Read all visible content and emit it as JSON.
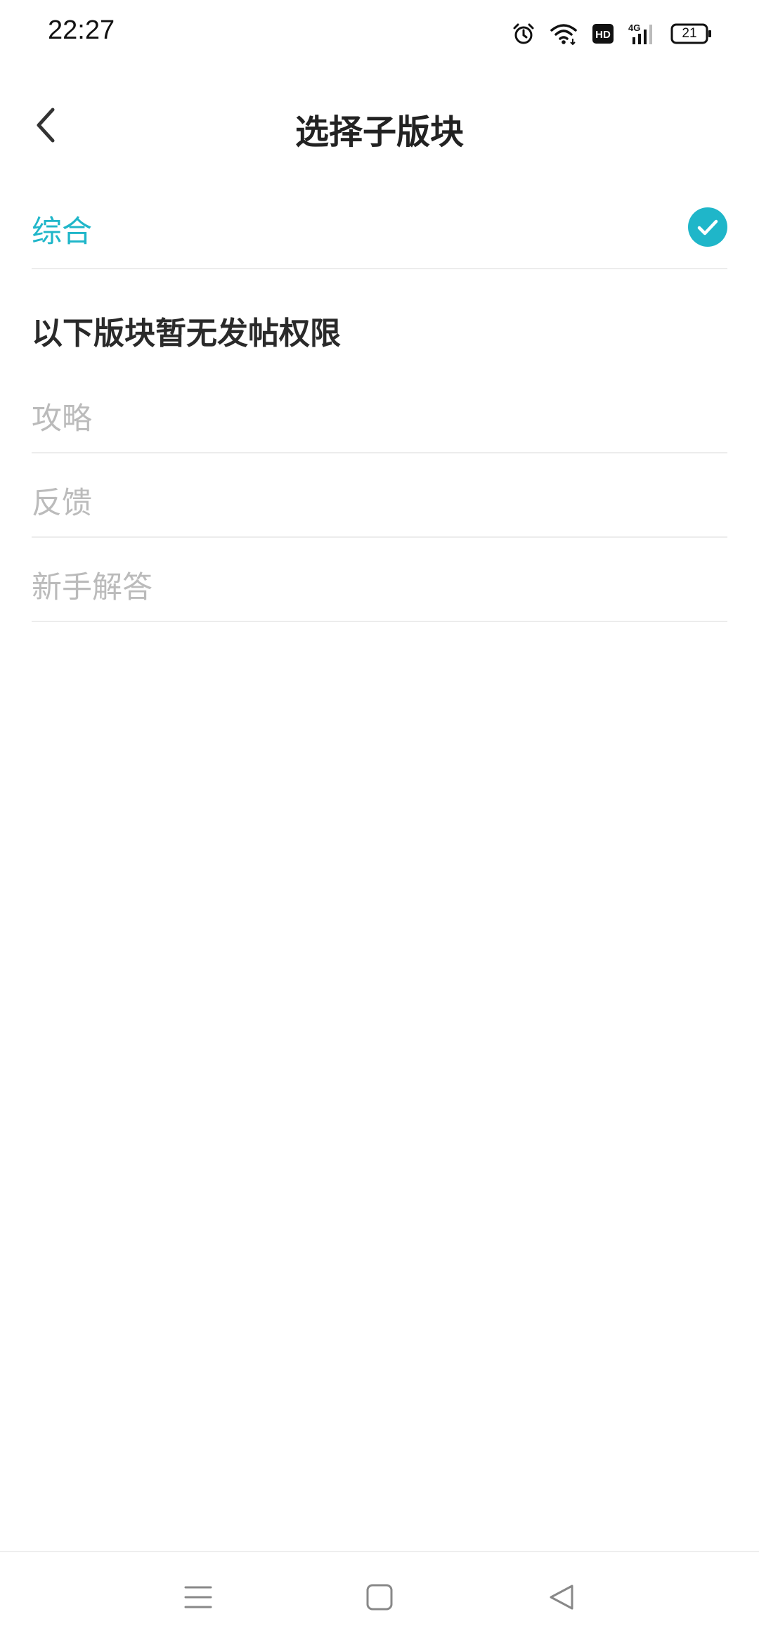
{
  "status_bar": {
    "time": "22:27",
    "battery": "21",
    "icons": [
      "alarm-icon",
      "wifi-icon",
      "hd-icon",
      "signal-4g-icon",
      "battery-icon"
    ]
  },
  "header": {
    "title": "选择子版块",
    "back_icon": "chevron-left-icon"
  },
  "selected_section": {
    "label": "综合",
    "icon": "check-circle-icon",
    "color": "#1fb6c9"
  },
  "restricted": {
    "heading": "以下版块暂无发帖权限",
    "items": [
      "攻略",
      "反馈",
      "新手解答"
    ]
  },
  "nav_bar": {
    "icons": [
      "menu-icon",
      "home-icon",
      "back-triangle-icon"
    ]
  }
}
